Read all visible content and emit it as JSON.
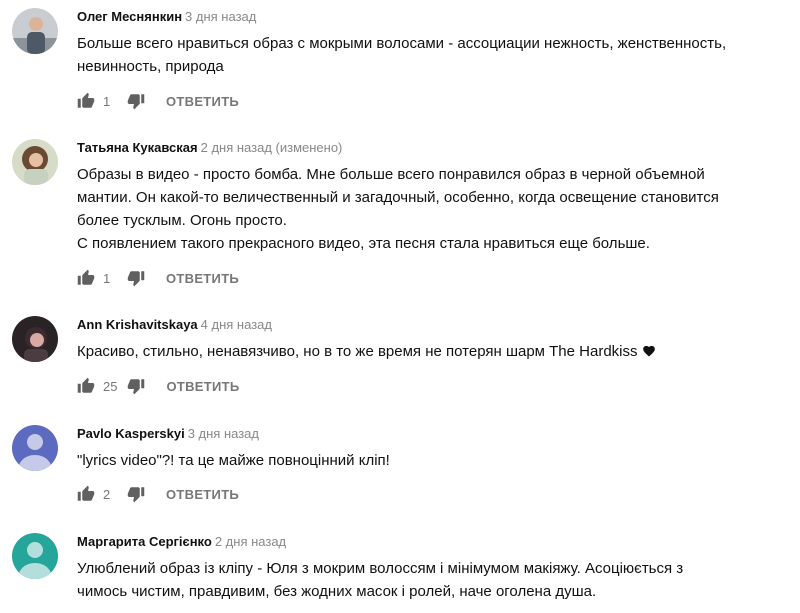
{
  "comments": [
    {
      "author": "Олег Меснянкин",
      "time": "3 дня назад",
      "lines": [
        "Больше всего нравиться образ с мокрыми волосами - ассоциации нежность, женственность,",
        "невинность, природа"
      ],
      "likes": "1",
      "reply": "ОТВЕТИТЬ",
      "avatar": "photo"
    },
    {
      "author": "Татьяна Кукавская",
      "time": "2 дня назад (изменено)",
      "lines": [
        "Образы в видео - просто бомба. Мне больше всего понравился образ в черной объемной",
        "мантии. Он какой-то величественный и загадочный, особенно, когда освещение становится",
        "более тусклым. Огонь просто.",
        "С появлением такого прекрасного видео, эта песня стала нравиться еще больше."
      ],
      "likes": "1",
      "reply": "ОТВЕТИТЬ",
      "avatar": "photo"
    },
    {
      "author": "Ann Krishavitskaya",
      "time": "4 дня назад",
      "lines": [
        "Красиво, стильно, ненавязчиво, но в то же время не потерян шарм The Hardkiss"
      ],
      "likes": "25",
      "reply": "ОТВЕТИТЬ",
      "avatar": "photo",
      "heart_icon": "heart-icon"
    },
    {
      "author": "Pavlo Kasperskyi",
      "time": "3 дня назад",
      "lines": [
        "\"lyrics video\"?! та це майже повноцінний кліп!"
      ],
      "likes": "2",
      "reply": "ОТВЕТИТЬ",
      "avatar": "default",
      "avatar_color": "#5c6bc0"
    },
    {
      "author": "Маргарита Сергієнко",
      "time": "2 дня назад",
      "lines": [
        "Улюблений образ із кліпу - Юля з мокрим волоссям і мінімумом макіяжу. Асоціюється з",
        "чимось чистим, правдивим, без жодних масок і ролей, наче оголена душа."
      ],
      "avatar": "default",
      "avatar_color": "#26a69a"
    }
  ],
  "icons": {
    "like": "thumb-up-icon",
    "dislike": "thumb-down-icon"
  },
  "colors": {
    "author": "#111111",
    "meta": "#888888",
    "action": "#777777"
  }
}
